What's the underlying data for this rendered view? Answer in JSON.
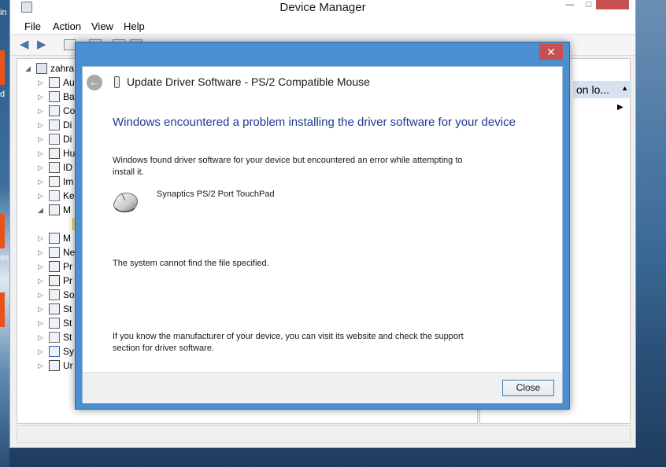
{
  "desktop": {
    "left_snippets": [
      "in",
      "d",
      "es"
    ]
  },
  "device_manager": {
    "title": "Device Manager",
    "window_controls": {
      "minimize": "—",
      "maximize": "□"
    },
    "menu": [
      "File",
      "Action",
      "View",
      "Help"
    ],
    "tree": {
      "root_label": "zahra",
      "items": [
        {
          "label": "Au",
          "expander": "▷"
        },
        {
          "label": "Ba",
          "expander": "▷"
        },
        {
          "label": "Co",
          "expander": "▷"
        },
        {
          "label": "Di",
          "expander": "▷"
        },
        {
          "label": "Di",
          "expander": "▷"
        },
        {
          "label": "Hu",
          "expander": "▷"
        },
        {
          "label": "ID",
          "expander": "▷"
        },
        {
          "label": "Im",
          "expander": "▷"
        },
        {
          "label": "Ke",
          "expander": "▷"
        },
        {
          "label": "M",
          "expander": "◢"
        },
        {
          "label": "",
          "expander": ""
        },
        {
          "label": "M",
          "expander": "▷"
        },
        {
          "label": "Ne",
          "expander": "▷"
        },
        {
          "label": "Pr",
          "expander": "▷"
        },
        {
          "label": "Pr",
          "expander": "▷"
        },
        {
          "label": "So",
          "expander": "▷"
        },
        {
          "label": "St",
          "expander": "▷"
        },
        {
          "label": "St",
          "expander": "▷"
        },
        {
          "label": "St",
          "expander": "▷"
        },
        {
          "label": "Sy",
          "expander": "▷"
        },
        {
          "label": "Ur",
          "expander": "▷"
        }
      ]
    },
    "right_pane": {
      "header": "on lo...",
      "header_arrow": "▲",
      "more_arrow": "▶"
    }
  },
  "dialog": {
    "close_glyph": "✕",
    "back_glyph": "←",
    "title": "Update Driver Software - PS/2 Compatible Mouse",
    "main_instruction": "Windows encountered a problem installing the driver software for your device",
    "found_text_line1": "Windows found driver software for your device but encountered an error while attempting to",
    "found_text_line2": "install it.",
    "device_name": "Synaptics PS/2 Port TouchPad",
    "error_text": "The system cannot find the file specified.",
    "manufacturer_text_line1": "If you know the manufacturer of your device, you can visit its website and check the support",
    "manufacturer_text_line2": "section for driver software.",
    "close_button_label": "Close"
  },
  "colors": {
    "dialog_frame": "#4b8fd1",
    "close_red": "#c75050",
    "instruction_blue": "#1b3a8f"
  }
}
